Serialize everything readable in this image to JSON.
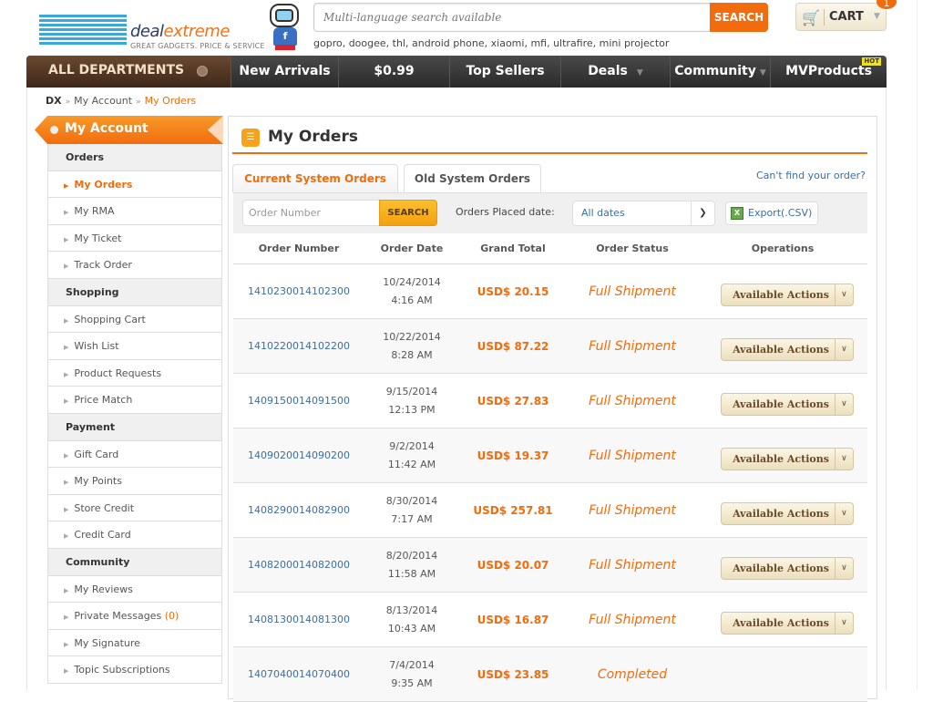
{
  "header": {
    "logo_deal": "deal",
    "logo_extreme": "extreme",
    "logo_tagline": "GREAT GADGETS. PRICE & SERVICE",
    "mascot_letter": "f",
    "search_placeholder": "Multi-language search available",
    "search_button": "SEARCH",
    "hot_terms": "gopro, doogee, thl, android phone, xiaomi, mfi, ultrafire, mini projector",
    "cart_label": "CART",
    "cart_count": "1"
  },
  "nav": {
    "departments": "ALL DEPARTMENTS",
    "items": [
      {
        "label": "New Arrivals"
      },
      {
        "label": "$0.99"
      },
      {
        "label": "Top Sellers"
      },
      {
        "label": "Deals"
      },
      {
        "label": "Community"
      },
      {
        "label": "MVProducts"
      }
    ],
    "hot_badge": "HOT"
  },
  "breadcrumb": {
    "root": "DX",
    "sep": "»",
    "account": "My Account",
    "current": "My Orders"
  },
  "sidebar": {
    "title": "My Account",
    "groups": [
      {
        "title": "Orders",
        "items": [
          {
            "label": "My Orders"
          },
          {
            "label": "My RMA"
          },
          {
            "label": "My Ticket"
          },
          {
            "label": "Track Order"
          }
        ]
      },
      {
        "title": "Shopping",
        "items": [
          {
            "label": "Shopping Cart"
          },
          {
            "label": "Wish List"
          },
          {
            "label": "Product Requests"
          },
          {
            "label": "Price Match"
          }
        ]
      },
      {
        "title": "Payment",
        "items": [
          {
            "label": "Gift Card"
          },
          {
            "label": "My Points"
          },
          {
            "label": "Store Credit"
          },
          {
            "label": "Credit Card"
          }
        ]
      },
      {
        "title": "Community",
        "items": [
          {
            "label": "My Reviews"
          },
          {
            "label": "Private Messages",
            "count": "(0)"
          },
          {
            "label": "My Signature"
          },
          {
            "label": "Topic Subscriptions"
          }
        ]
      }
    ]
  },
  "main": {
    "title": "My Orders",
    "tabs": [
      {
        "label": "Current System Orders"
      },
      {
        "label": "Old System Orders"
      }
    ],
    "cant_find": "Can't find your order?",
    "order_placeholder": "Order Number",
    "search_button": "SEARCH",
    "placed_label": "Orders Placed date:",
    "date_selected": "All dates",
    "export_label": "Export(.CSV)",
    "columns": [
      "Order Number",
      "Order Date",
      "Grand Total",
      "Order Status",
      "Operations"
    ],
    "actions_label": "Available Actions",
    "orders": [
      {
        "number": "1410230014102300",
        "date": "10/24/2014",
        "time": "4:16 AM",
        "total": "USD$ 20.15",
        "status": "Full Shipment",
        "has_actions": true
      },
      {
        "number": "1410220014102200",
        "date": "10/22/2014",
        "time": "8:28 AM",
        "total": "USD$ 87.22",
        "status": "Full Shipment",
        "has_actions": true
      },
      {
        "number": "1409150014091500",
        "date": "9/15/2014",
        "time": "12:13 PM",
        "total": "USD$ 27.83",
        "status": "Full Shipment",
        "has_actions": true
      },
      {
        "number": "1409020014090200",
        "date": "9/2/2014",
        "time": "11:42 AM",
        "total": "USD$ 19.37",
        "status": "Full Shipment",
        "has_actions": true
      },
      {
        "number": "1408290014082900",
        "date": "8/30/2014",
        "time": "7:17 AM",
        "total": "USD$ 257.81",
        "status": "Full Shipment",
        "has_actions": true
      },
      {
        "number": "1408200014082000",
        "date": "8/20/2014",
        "time": "11:58 AM",
        "total": "USD$ 20.07",
        "status": "Full Shipment",
        "has_actions": true
      },
      {
        "number": "1408130014081300",
        "date": "8/13/2014",
        "time": "10:43 AM",
        "total": "USD$ 16.87",
        "status": "Full Shipment",
        "has_actions": true
      },
      {
        "number": "1407040014070400",
        "date": "7/4/2014",
        "time": "9:35 AM",
        "total": "USD$ 23.85",
        "status": "Completed",
        "has_actions": false
      }
    ]
  },
  "colors": {
    "accent": "#f26c0d",
    "link": "#3a6ea5",
    "logo_blue": "#3aa8dc"
  }
}
